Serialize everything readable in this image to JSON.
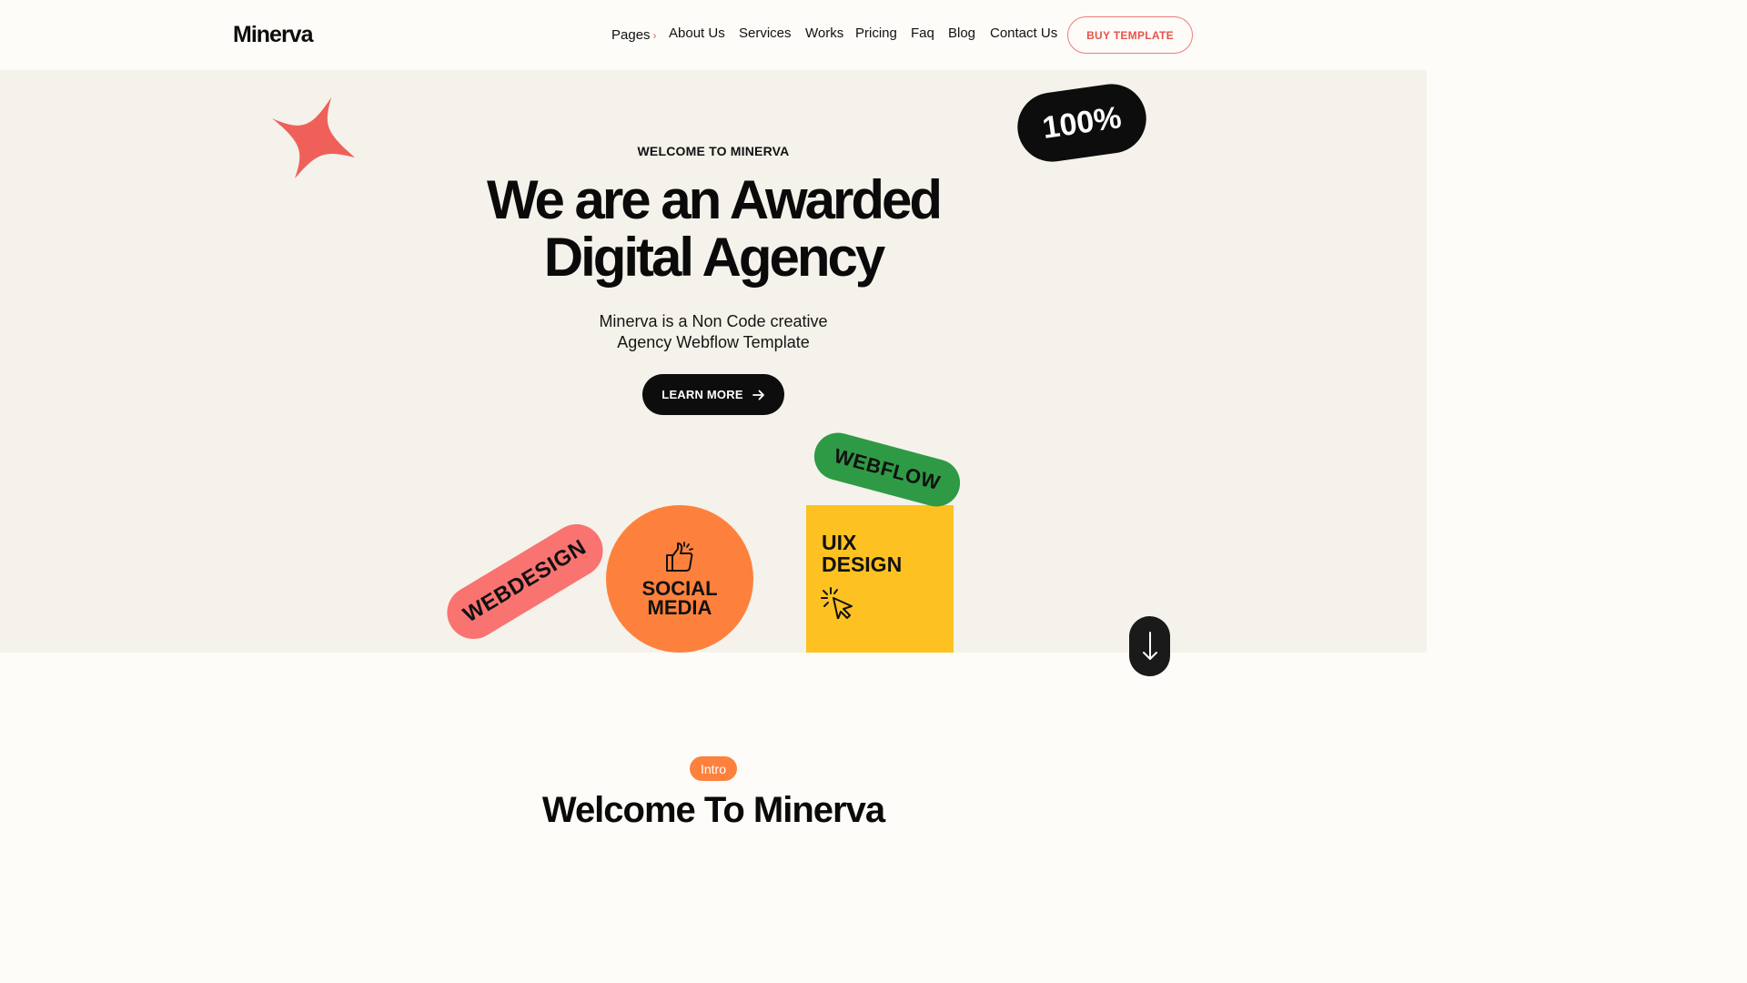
{
  "brand": {
    "logo": "Minerva"
  },
  "nav": {
    "pages": "Pages",
    "items": [
      "About Us",
      "Services",
      "Works",
      "Pricing",
      "Faq",
      "Blog",
      "Contact Us"
    ],
    "cta": "BUY TEMPLATE"
  },
  "hero": {
    "eyebrow": "WELCOME TO MINERVA",
    "headline_line1": "We are an Awarded",
    "headline_line2": "Digital Agency",
    "sub_line1": "Minerva is a Non Code creative",
    "sub_line2": "Agency Webflow Template",
    "button": "LEARN MORE",
    "badge": "100%",
    "stickers": {
      "webdesign": "WEBDESIGN",
      "social_line1": "SOCIAL",
      "social_line2": "MEDIA",
      "uix_line1": "UIX",
      "uix_line2": "DESIGN",
      "webflow": "WEBFLOW"
    }
  },
  "intro": {
    "badge": "Intro",
    "title": "Welcome To Minerva"
  },
  "colors": {
    "accent_coral": "#f97371",
    "accent_orange": "#fd813d",
    "accent_yellow": "#fdc221",
    "accent_green": "#2f9a45",
    "hero_bg": "#f4f2ea"
  }
}
